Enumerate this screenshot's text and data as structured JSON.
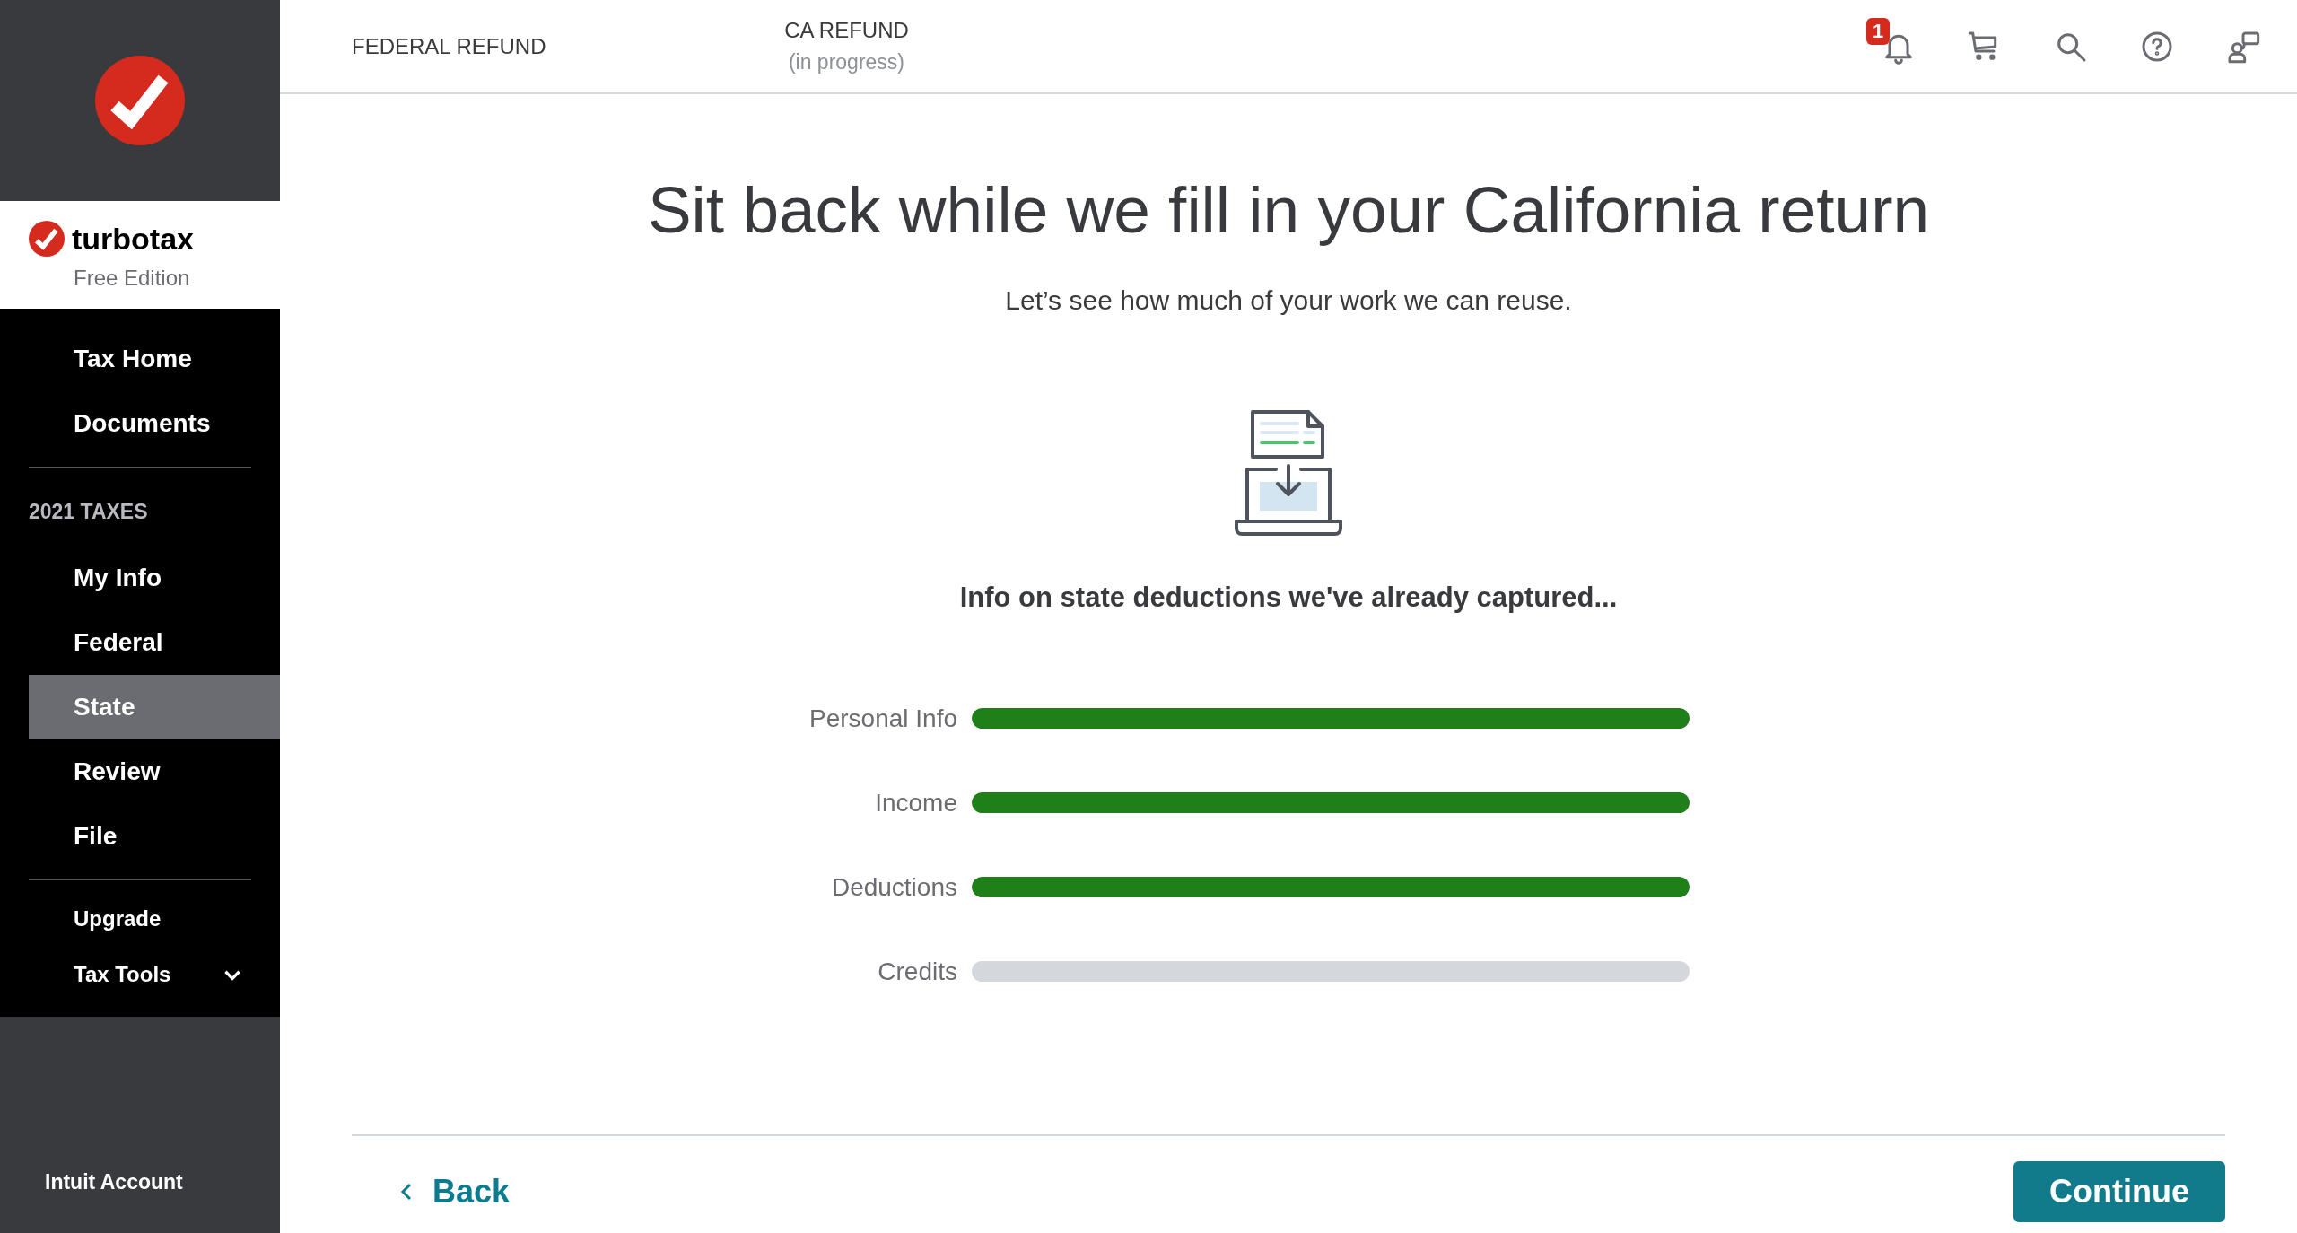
{
  "sidebar": {
    "brand": {
      "name": "turbotax",
      "edition": "Free Edition"
    },
    "items": [
      {
        "kind": "link",
        "label": "Tax Home",
        "selected": false
      },
      {
        "kind": "link",
        "label": "Documents",
        "selected": false
      },
      {
        "kind": "divider"
      },
      {
        "kind": "heading",
        "label": "2021 TAXES"
      },
      {
        "kind": "link",
        "label": "My Info",
        "selected": false
      },
      {
        "kind": "link",
        "label": "Federal",
        "selected": false
      },
      {
        "kind": "link",
        "label": "State",
        "selected": true
      },
      {
        "kind": "link",
        "label": "Review",
        "selected": false
      },
      {
        "kind": "link",
        "label": "File",
        "selected": false
      },
      {
        "kind": "divider"
      },
      {
        "kind": "small",
        "label": "Upgrade",
        "selected": false
      },
      {
        "kind": "expander",
        "label": "Tax Tools",
        "expanded": false
      }
    ],
    "account": "Intuit Account"
  },
  "header": {
    "refunds": [
      {
        "label": "FEDERAL REFUND"
      },
      {
        "label": "CA REFUND",
        "status": "(in progress)"
      }
    ],
    "notification_count": "1"
  },
  "main": {
    "title": "Sit back while we fill in your California return",
    "subtitle": "Let’s see how much of your work we can reuse.",
    "caption": "Info on state deductions we've already captured...",
    "progress": [
      {
        "label": "Personal Info",
        "level": 1
      },
      {
        "label": "Income",
        "level": 1
      },
      {
        "label": "Deductions",
        "level": 1
      },
      {
        "label": "Credits",
        "level": 0
      }
    ],
    "back": "Back",
    "continue": "Continue"
  }
}
